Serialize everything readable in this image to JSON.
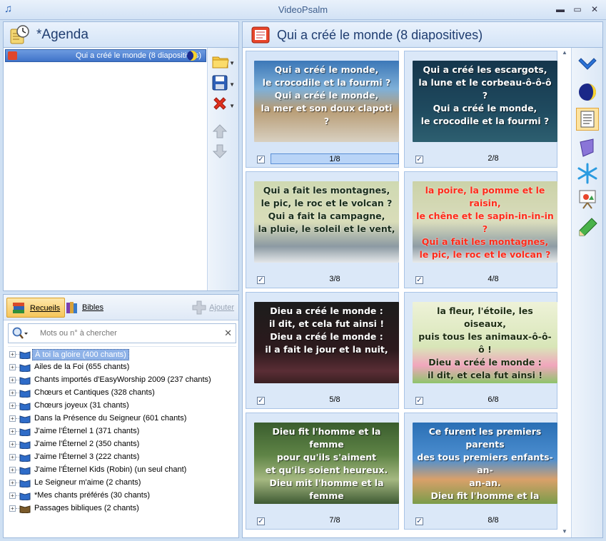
{
  "window": {
    "title": "VideoPsalm"
  },
  "agenda": {
    "title": "*Agenda",
    "items": [
      {
        "label": "Qui a créé le monde (8 diapositives)"
      }
    ]
  },
  "library": {
    "tabs": [
      {
        "label": "Recueils"
      },
      {
        "label": "Bibles"
      }
    ],
    "add_label": "Ajouter",
    "search": {
      "placeholder": "Mots ou n° à chercher",
      "value": ""
    },
    "collections": [
      {
        "label": "À toi la gloire (400 chants)",
        "selected": true
      },
      {
        "label": "Ailes de la Foi (655 chants)"
      },
      {
        "label": "Chants importés d'EasyWorship 2009 (237 chants)"
      },
      {
        "label": "Chœurs et Cantiques (328 chants)"
      },
      {
        "label": "Chœurs joyeux (31 chants)"
      },
      {
        "label": "Dans la Présence du Seigneur (601 chants)"
      },
      {
        "label": "J'aime l'Éternel 1 (371 chants)"
      },
      {
        "label": "J'aime l'Éternel 2 (350 chants)"
      },
      {
        "label": "J'aime l'Éternel 3 (222 chants)"
      },
      {
        "label": "J'aime l'Éternel Kids (Robin) (un seul chant)"
      },
      {
        "label": "Le Seigneur m'aime (2 chants)"
      },
      {
        "label": "*Mes chants préférés (30 chants)"
      },
      {
        "label": "Passages bibliques (2 chants)"
      }
    ]
  },
  "presentation": {
    "title": "Qui a créé le monde (8 diapositives)",
    "slides": [
      {
        "counter": "1/8",
        "checked": true,
        "selected": true,
        "text": "Qui a créé le monde,\nle crocodile et la fourmi ?\nQui a créé le monde,\nla mer et son doux clapoti ?",
        "bg": "linear-gradient(180deg,#3c78b8 0%,#7fb0d8 35%,#b79b73 60%,#d8d0c1 100%)",
        "color": "#ffffff"
      },
      {
        "counter": "2/8",
        "checked": true,
        "text": "Qui a créé les escargots,\nla lune et le corbeau-ô-ô-ô ?\nQui a créé le monde,\nle crocodile et la fourmi ?",
        "bg": "linear-gradient(180deg,#15364c 0%,#1f4a5f 60%,#2d5f70 100%)",
        "color": "#ffffff"
      },
      {
        "counter": "3/8",
        "checked": true,
        "text": "Qui a fait les montagnes,\nle pic, le roc et le volcan ?\nQui a fait la campagne,\nla pluie, le soleil et le vent,",
        "bg": "linear-gradient(180deg,#cfd9b2 0%,#d9ddb9 50%,#8c9aa3 80%,#e4e7e9 100%)",
        "color": "#1a2e1c"
      },
      {
        "counter": "4/8",
        "checked": true,
        "text": "la poire, la pomme et le\nraisin,\nle chêne et le sapin-in-in-in ?\nQui a fait les montagnes,\nle pic, le roc et le volcan ?",
        "bg": "linear-gradient(180deg,#cbd2a8 0%,#d9dcbc 50%,#8e9ca5 80%,#e8eaea 100%)",
        "color": "#ff2a1a"
      },
      {
        "counter": "5/8",
        "checked": true,
        "text": "Dieu a créé le monde :\nil dit, et cela fut ainsi !\nDieu a créé le monde :\nil a fait le jour et la nuit,",
        "bg": "linear-gradient(180deg,#1c1c1c 0%,#2d1a1d 60%,#5a2d35 85%,#3a2022 100%)",
        "color": "#ffffff"
      },
      {
        "counter": "6/8",
        "checked": true,
        "text": "la fleur, l'étoile, les oiseaux,\npuis tous les animaux-ô-ô-ô !\nDieu a créé le monde :\nil dit, et cela fut ainsi !",
        "bg": "linear-gradient(180deg,#eef2d8 0%,#d8e6b8 55%,#f1a6bd 78%,#8ec46b 100%)",
        "color": "#1e2e12"
      },
      {
        "counter": "7/8",
        "checked": true,
        "text": "Dieu fit l'homme et la femme\npour qu'ils s'aiment\net qu'ils soient heureux.\nDieu mit l'homme et la femme\ndans son jardin si merveilleux.",
        "bg": "linear-gradient(180deg,#3a5d2e 0%,#5f8446 40%,#a5b881 70%,#3e5a33 100%)",
        "color": "#ffffff"
      },
      {
        "counter": "8/8",
        "checked": true,
        "text": "Ce furent les premiers parents\ndes tous premiers enfants-an-\nan-an.\nDieu fit l'homme et la femme\npour qu'ils s'aiment\net qu'ils soient heureux.",
        "bg": "linear-gradient(180deg,#2a6fb5 0%,#4d8fd0 45%,#d9a06a 70%,#7a9c4a 100%)",
        "color": "#ffffff"
      }
    ]
  },
  "icons": {
    "agenda": "clock-icon",
    "presentation": "slides-icon",
    "tools_left": [
      "open-folder-icon",
      "save-icon",
      "delete-icon",
      "move-up-icon",
      "move-down-icon"
    ],
    "tools_right": [
      "check-icon",
      "moon-icon",
      "text-icon",
      "shape-icon",
      "snowflake-icon",
      "presentation-board-icon",
      "pencil-icon"
    ]
  },
  "colors": {
    "accent": "#3f73c9",
    "selection": "#8fb3e8",
    "active_tab": "#f6c65a"
  }
}
